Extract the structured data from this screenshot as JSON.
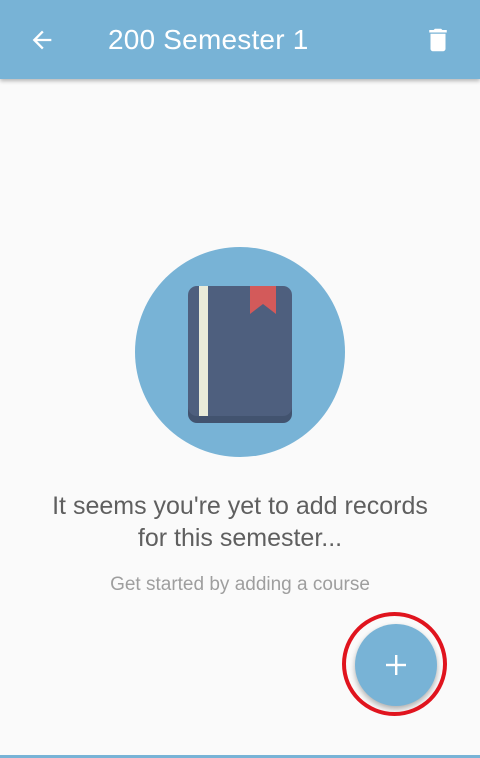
{
  "toolbar": {
    "title": "200 Semester 1",
    "back_icon": "arrow-left-icon",
    "delete_icon": "trash-icon"
  },
  "empty_state": {
    "illustration_icon": "book-icon",
    "message_line1": "It seems you're yet to add records",
    "message_line2": "for this semester...",
    "hint": "Get started by adding a course"
  },
  "fab": {
    "icon": "plus-icon"
  },
  "colors": {
    "primary": "#78b3d6",
    "background": "#fafafa",
    "book_cover": "#4e5f7e",
    "book_spine": "#e9ebd9",
    "bookmark": "#d35a5a",
    "highlight": "#e0141e"
  }
}
